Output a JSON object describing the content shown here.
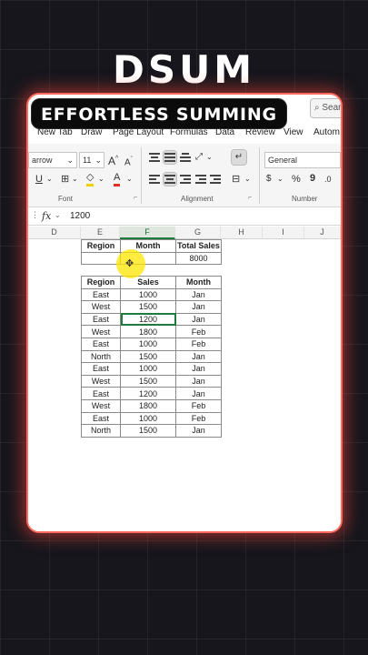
{
  "overlay": {
    "title": "DSUM",
    "badge": "EFFORTLESS SUMMING"
  },
  "ribbon": {
    "search_text": "Searc",
    "tabs": [
      "New Tab",
      "Draw",
      "Page Layout",
      "Formulas",
      "Data",
      "Review",
      "View",
      "Autom"
    ],
    "font_name": "arrow",
    "font_size": "11",
    "font_grow": "A",
    "font_shrink": "A",
    "underline": "U",
    "font_color_glyph": "A",
    "number_format": "General",
    "percent": "%",
    "comma": "9",
    "groups": {
      "font": "Font",
      "alignment": "Alignment",
      "number": "Number"
    },
    "dialog_launcher": "⌐"
  },
  "formula_bar": {
    "fx": "fx",
    "value": "1200"
  },
  "columns": [
    "D",
    "E",
    "F",
    "G",
    "H",
    "I",
    "J"
  ],
  "criteria": {
    "headers": [
      "Region",
      "Month",
      "Total Sales"
    ],
    "result": "8000"
  },
  "data_table": {
    "headers": [
      "Region",
      "Sales",
      "Month"
    ],
    "rows": [
      [
        "East",
        "1000",
        "Jan"
      ],
      [
        "West",
        "1500",
        "Jan"
      ],
      [
        "East",
        "1200",
        "Jan"
      ],
      [
        "West",
        "1800",
        "Feb"
      ],
      [
        "East",
        "1000",
        "Feb"
      ],
      [
        "North",
        "1500",
        "Jan"
      ],
      [
        "East",
        "1000",
        "Jan"
      ],
      [
        "West",
        "1500",
        "Jan"
      ],
      [
        "East",
        "1200",
        "Jan"
      ],
      [
        "West",
        "1800",
        "Feb"
      ],
      [
        "East",
        "1000",
        "Feb"
      ],
      [
        "North",
        "1500",
        "Jan"
      ]
    ]
  },
  "colors": {
    "accent": "#1f7a3e",
    "glow": "#ff4a3c",
    "highlight": "#ffe600"
  }
}
